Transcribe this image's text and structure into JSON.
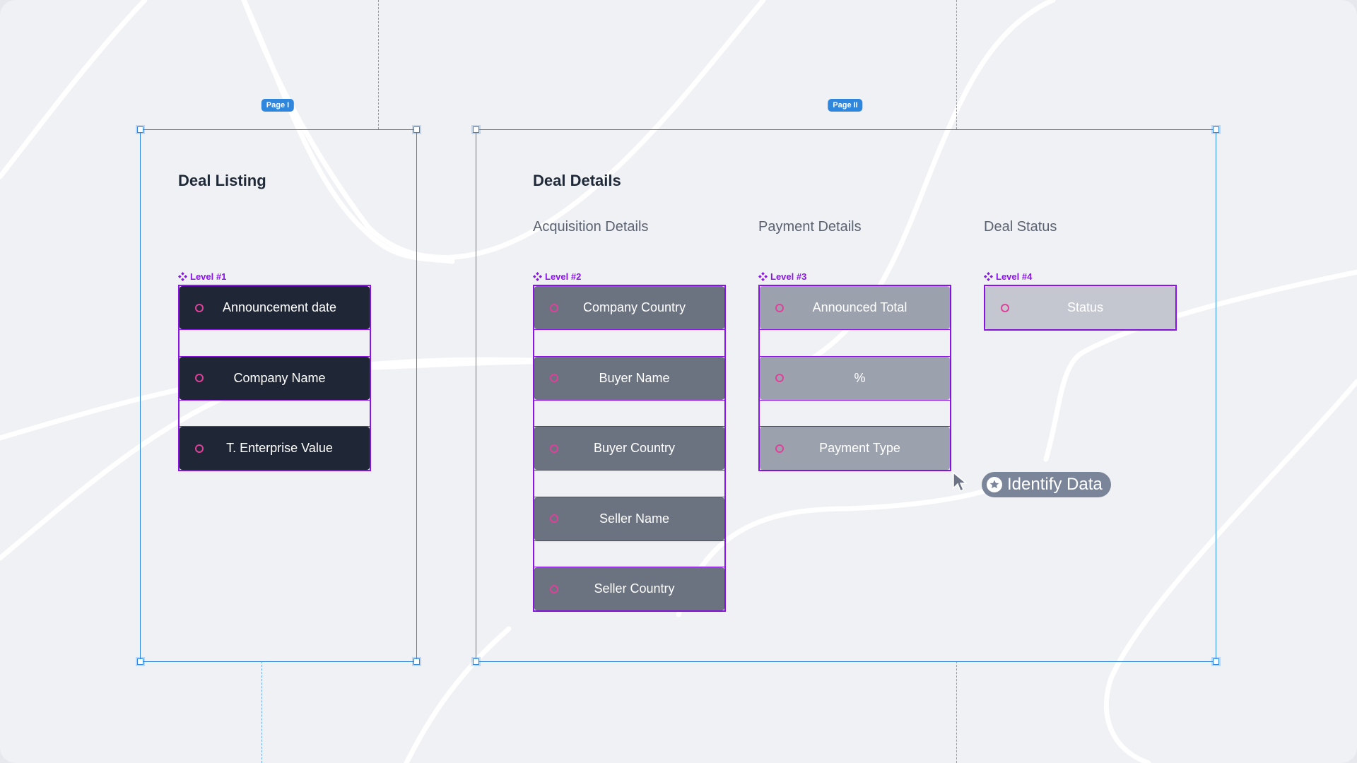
{
  "pages": [
    {
      "badge": "Page I",
      "title": "Deal Listing",
      "sections": [
        {
          "heading": "",
          "level": "Level #1",
          "style": "dark",
          "fields": [
            "Announcement date",
            "Company Name",
            "T. Enterprise Value"
          ]
        }
      ]
    },
    {
      "badge": "Page II",
      "title": "Deal Details",
      "sections": [
        {
          "heading": "Acquisition Details",
          "level": "Level #2",
          "style": "mid",
          "fields": [
            "Company Country",
            "Buyer Name",
            "Buyer Country",
            "Seller Name",
            "Seller Country"
          ]
        },
        {
          "heading": "Payment Details",
          "level": "Level #3",
          "style": "light",
          "fields": [
            "Announced Total",
            "%",
            "Payment Type"
          ]
        },
        {
          "heading": "Deal Status",
          "level": "Level #4",
          "style": "pale",
          "fields": [
            "Status"
          ]
        }
      ]
    }
  ],
  "tooltip": {
    "icon": "star-icon",
    "label": "Identify Data"
  },
  "colors": {
    "selection": "#2f86dd",
    "level_outline": "#8b14e8",
    "field_marker": "#e0409a",
    "tooltip_bg": "#7b8599"
  }
}
